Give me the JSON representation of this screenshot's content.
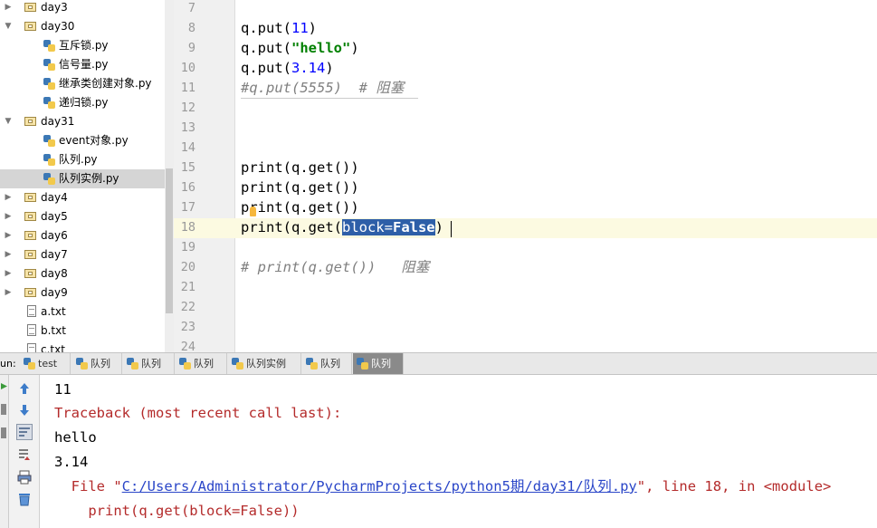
{
  "project_tree": {
    "items": [
      {
        "label": "day3",
        "type": "folder",
        "expanded": false,
        "indent": 0
      },
      {
        "label": "day30",
        "type": "folder",
        "expanded": true,
        "indent": 0
      },
      {
        "label": "互斥锁.py",
        "type": "py",
        "indent": 1
      },
      {
        "label": "信号量.py",
        "type": "py",
        "indent": 1
      },
      {
        "label": "继承类创建对象.py",
        "type": "py",
        "indent": 1
      },
      {
        "label": "递归锁.py",
        "type": "py",
        "indent": 1
      },
      {
        "label": "day31",
        "type": "folder",
        "expanded": true,
        "indent": 0
      },
      {
        "label": "event对象.py",
        "type": "py",
        "indent": 1
      },
      {
        "label": "队列.py",
        "type": "py",
        "indent": 1
      },
      {
        "label": "队列实例.py",
        "type": "py",
        "indent": 1,
        "selected": true
      },
      {
        "label": "day4",
        "type": "folder",
        "expanded": false,
        "indent": 0
      },
      {
        "label": "day5",
        "type": "folder",
        "expanded": false,
        "indent": 0
      },
      {
        "label": "day6",
        "type": "folder",
        "expanded": false,
        "indent": 0
      },
      {
        "label": "day7",
        "type": "folder",
        "expanded": false,
        "indent": 0
      },
      {
        "label": "day8",
        "type": "folder",
        "expanded": false,
        "indent": 0
      },
      {
        "label": "day9",
        "type": "folder",
        "expanded": false,
        "indent": 0
      },
      {
        "label": "a.txt",
        "type": "txt",
        "indent": 0
      },
      {
        "label": "b.txt",
        "type": "txt",
        "indent": 0
      },
      {
        "label": "c.txt",
        "type": "txt",
        "indent": 0
      }
    ]
  },
  "editor": {
    "line_numbers": [
      "7",
      "8",
      "9",
      "10",
      "11",
      "12",
      "13",
      "14",
      "15",
      "16",
      "17",
      "18",
      "19",
      "20",
      "21",
      "22",
      "23",
      "24"
    ],
    "current_line": "18",
    "code": {
      "l8_pre": "q.put(",
      "l8_num": "11",
      "l8_post": ")",
      "l9_pre": "q.put(",
      "l9_str": "\"hello\"",
      "l9_post": ")",
      "l10_pre": "q.put(",
      "l10_num": "3.14",
      "l10_post": ")",
      "l11_cmt": "#q.put(5555)  # 阻塞",
      "l15": "print(q.get())",
      "l16": "print(q.get())",
      "l17": "print(q.get())",
      "l18_pre": "print(q.get(",
      "l18_sel_a": "block=",
      "l18_sel_b": "False",
      "l18_post": ")",
      "l20_cmt": "# print(q.get())   阻塞"
    }
  },
  "run_bar": {
    "label": "un:",
    "tabs": [
      {
        "label": "test",
        "active": false
      },
      {
        "label": "队列",
        "active": false
      },
      {
        "label": "队列",
        "active": false
      },
      {
        "label": "队列",
        "active": false
      },
      {
        "label": "队列实例",
        "active": false
      },
      {
        "label": "队列",
        "active": false
      },
      {
        "label": "队列",
        "active": true
      }
    ]
  },
  "console": {
    "line1": "11",
    "line2": "Traceback (most recent call last):",
    "line3": "hello",
    "line4": "3.14",
    "file_pre": "  File \"",
    "file_link": "C:/Users/Administrator/PycharmProjects/python5期/day31/队列.py",
    "file_post": "\", line 18, in <module>",
    "line6": "    print(q.get(block=False))"
  },
  "colors": {
    "selection": "#2e5fa8",
    "current_line": "#fcfae1",
    "error_text": "#b42b2b",
    "link": "#2a46c8",
    "active_tab": "#8a8a8a"
  }
}
